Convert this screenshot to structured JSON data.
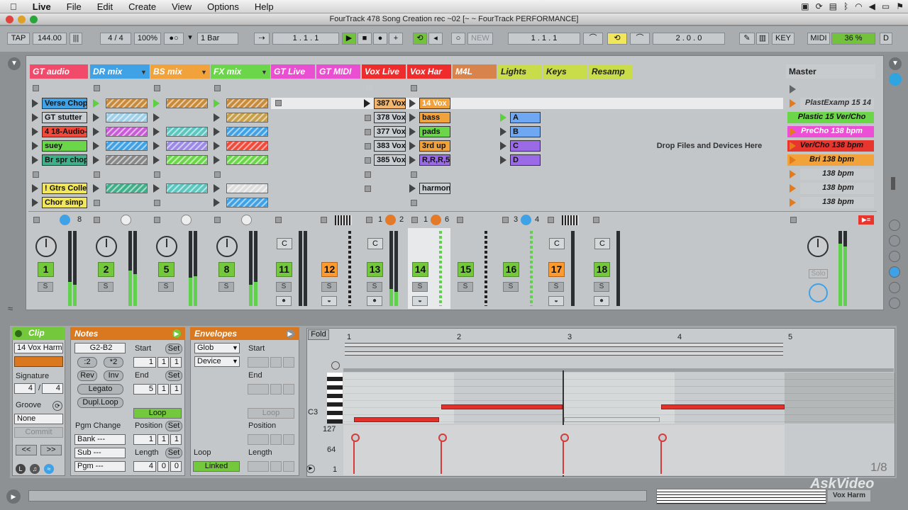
{
  "menubar": {
    "apple": "",
    "app_name": "Live",
    "items": [
      "File",
      "Edit",
      "Create",
      "View",
      "Options",
      "Help"
    ]
  },
  "window": {
    "title": "FourTrack 478 Song Creation rec ~02  [~ ~ FourTrack PERFORMANCE]"
  },
  "transport": {
    "tap": "TAP",
    "tempo": "144.00",
    "signature": "4 / 4",
    "zoom": "100%",
    "quantize": "1 Bar",
    "position": "1 .   1 .   1",
    "new": "NEW",
    "loop_start": "1 .   1 .   1",
    "loop_length": "2 .   0 .   0",
    "key": "KEY",
    "midi": "MIDI",
    "cpu": "36 %",
    "d": "D"
  },
  "tracks": [
    {
      "name": "GT audio",
      "color": "#f24a6a",
      "number": "1",
      "clips": [
        "Verse Chop",
        "GT stutter",
        "4 18-Audio-",
        "suey",
        "Br spr chop",
        "",
        "! Gtrs Collec",
        "Chor simp"
      ]
    },
    {
      "name": "DR mix",
      "color": "#3fa1e6",
      "number": "2"
    },
    {
      "name": "BS mix",
      "color": "#f2a23a",
      "number": "5"
    },
    {
      "name": "FX mix",
      "color": "#6cd64a",
      "number": "8"
    },
    {
      "name": "GT Live",
      "color": "#e94fd0",
      "number": "11"
    },
    {
      "name": "GT MIDI",
      "color": "#e94fd0",
      "number": "12"
    },
    {
      "name": "Vox Live",
      "color": "#f02b2b",
      "number": "13",
      "clips": [
        "387 Vox",
        "378 Vox",
        "377 Vox",
        "383 Vox",
        "385 Vox"
      ]
    },
    {
      "name": "Vox Har",
      "color": "#f02b2b",
      "number": "14",
      "clips": [
        "14 Vox H",
        "bass",
        "pads",
        "3rd up",
        "R,R,R,5",
        "",
        "harmon"
      ]
    },
    {
      "name": "M4L",
      "color": "#d9834c",
      "number": "15"
    },
    {
      "name": "Lights",
      "color": "#c9dc4a",
      "number": "16",
      "clips": [
        "A",
        "B",
        "C",
        "D"
      ]
    },
    {
      "name": "Keys",
      "color": "#c9dc4a",
      "number": "17"
    },
    {
      "name": "Resamp",
      "color": "#c9dc4a",
      "number": "18"
    }
  ],
  "drop_zone": "Drop Files and Devices Here",
  "master": {
    "name": "Master",
    "scenes": [
      "PlastExamp 15 14",
      "Plastic 15 Ver/Cho",
      "PreCho 138 bpm",
      "Ver/Cho 138 bpm",
      "Bri 138 bpm",
      "138 bpm",
      "138 bpm",
      "138 bpm"
    ],
    "solo": "Solo"
  },
  "mixer_labels": {
    "s": "S",
    "c": "C"
  },
  "sends": {
    "a": "8",
    "vox_live_a": "1",
    "vox_live_b": "2",
    "vox_har_a": "1",
    "vox_har_b": "6",
    "lights_a": "3",
    "lights_b": "4"
  },
  "clip_panel": {
    "title": "Clip",
    "name": "14 Vox Harm",
    "signature_label": "Signature",
    "sig_num": "4",
    "sig_den": "4",
    "groove_label": "Groove",
    "groove": "None",
    "commit": "Commit",
    "prev": "<<",
    "next": ">>"
  },
  "notes_panel": {
    "title": "Notes",
    "range": "G2-B2",
    "div2": ":2",
    "mul2": "*2",
    "rev": "Rev",
    "inv": "Inv",
    "legato": "Legato",
    "dupl": "Dupl.Loop",
    "pgm_change": "Pgm Change",
    "bank": "Bank ---",
    "sub": "Sub ---",
    "pgm": "Pgm ---",
    "start_label": "Start",
    "end_label": "End",
    "set": "Set",
    "start": [
      "1",
      "1",
      "1"
    ],
    "end": [
      "5",
      "1",
      "1"
    ],
    "loop": "Loop",
    "position_label": "Position",
    "position": [
      "1",
      "1",
      "1"
    ],
    "length_label": "Length",
    "length": [
      "4",
      "0",
      "0"
    ]
  },
  "envelopes_panel": {
    "title": "Envelopes",
    "scope": "Glob",
    "device": "Device",
    "start_label": "Start",
    "end_label": "End",
    "loop_btn": "Loop",
    "position_label": "Position",
    "loop_label": "Loop",
    "linked": "Linked",
    "length_label": "Length"
  },
  "editor": {
    "fold": "Fold",
    "bars": [
      "1",
      "2",
      "3",
      "4",
      "5"
    ],
    "key_label": "C3",
    "velocity_labels": [
      "127",
      "64",
      "1"
    ],
    "grid": "1/8"
  },
  "status": {
    "track": "Vox Harm"
  },
  "watermark": "AskVideo"
}
